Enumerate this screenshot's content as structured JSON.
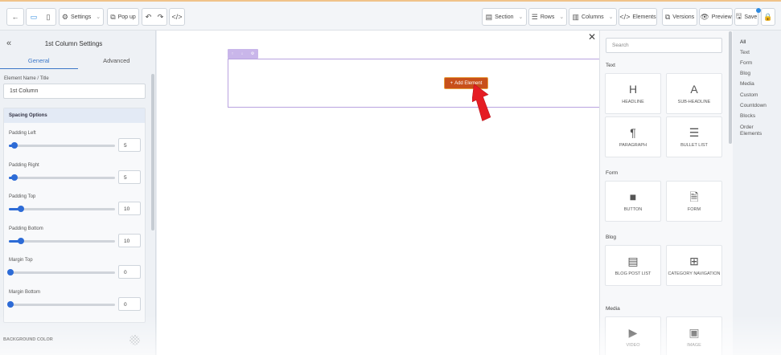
{
  "toolbar": {
    "back_icon": "arrow-left-icon",
    "desktop_icon": "desktop-icon",
    "mobile_icon": "mobile-icon",
    "settings": "Settings",
    "popup": "Pop up",
    "undo_icon": "undo-icon",
    "redo_icon": "redo-icon",
    "code_icon": "code-icon",
    "section": "Section",
    "rows": "Rows",
    "columns": "Columns",
    "elements": "Elements",
    "versions": "Versions",
    "preview": "Preview",
    "save": "Save",
    "accent": "#2d8ae0"
  },
  "left_panel": {
    "title": "1st Column Settings",
    "tabs": [
      "General",
      "Advanced"
    ],
    "active_tab": "General",
    "name_label": "Element Name / Title",
    "name_value": "1st Column",
    "spacing_header": "Spacing Options",
    "sliders": [
      {
        "label": "Padding Left",
        "value": "5",
        "level": 0.04
      },
      {
        "label": "Padding Right",
        "value": "5",
        "level": 0.04
      },
      {
        "label": "Padding Top",
        "value": "10",
        "level": 0.1
      },
      {
        "label": "Padding Bottom",
        "value": "10",
        "level": 0.1
      },
      {
        "label": "Margin Top",
        "value": "0",
        "level": 0
      },
      {
        "label": "Margin Bottom",
        "value": "0",
        "level": 0
      }
    ],
    "bg_color_label": "BACKGROUND COLOR",
    "slider_color": "#2d6bd6"
  },
  "canvas": {
    "add_element_label": "Add Element",
    "add_element_color": "#c8501a",
    "row_tools": [
      "↑",
      "↓",
      "⚙"
    ]
  },
  "elements_panel": {
    "search_placeholder": "Search",
    "categories": [
      {
        "name": "Text",
        "items": [
          {
            "label": "HEADLINE",
            "glyph": "H"
          },
          {
            "label": "SUB-HEADLINE",
            "glyph": "A"
          },
          {
            "label": "PARAGRAPH",
            "glyph": "¶"
          },
          {
            "label": "BULLET LIST",
            "glyph": "☰"
          }
        ]
      },
      {
        "name": "Form",
        "items": [
          {
            "label": "BUTTON",
            "glyph": "■"
          },
          {
            "label": "FORM",
            "glyph": "🗎"
          }
        ]
      },
      {
        "name": "Blog",
        "items": [
          {
            "label": "BLOG POST LIST",
            "glyph": "▤"
          },
          {
            "label": "CATEGORY NAVIGATION",
            "glyph": "⊞"
          }
        ]
      },
      {
        "name": "Media",
        "items": [
          {
            "label": "VIDEO",
            "glyph": "▶"
          },
          {
            "label": "IMAGE",
            "glyph": "▣"
          }
        ]
      }
    ]
  },
  "category_nav": [
    "All",
    "Text",
    "Form",
    "Blog",
    "Media",
    "Custom",
    "Countdown",
    "Blocks",
    "Order Elements"
  ]
}
